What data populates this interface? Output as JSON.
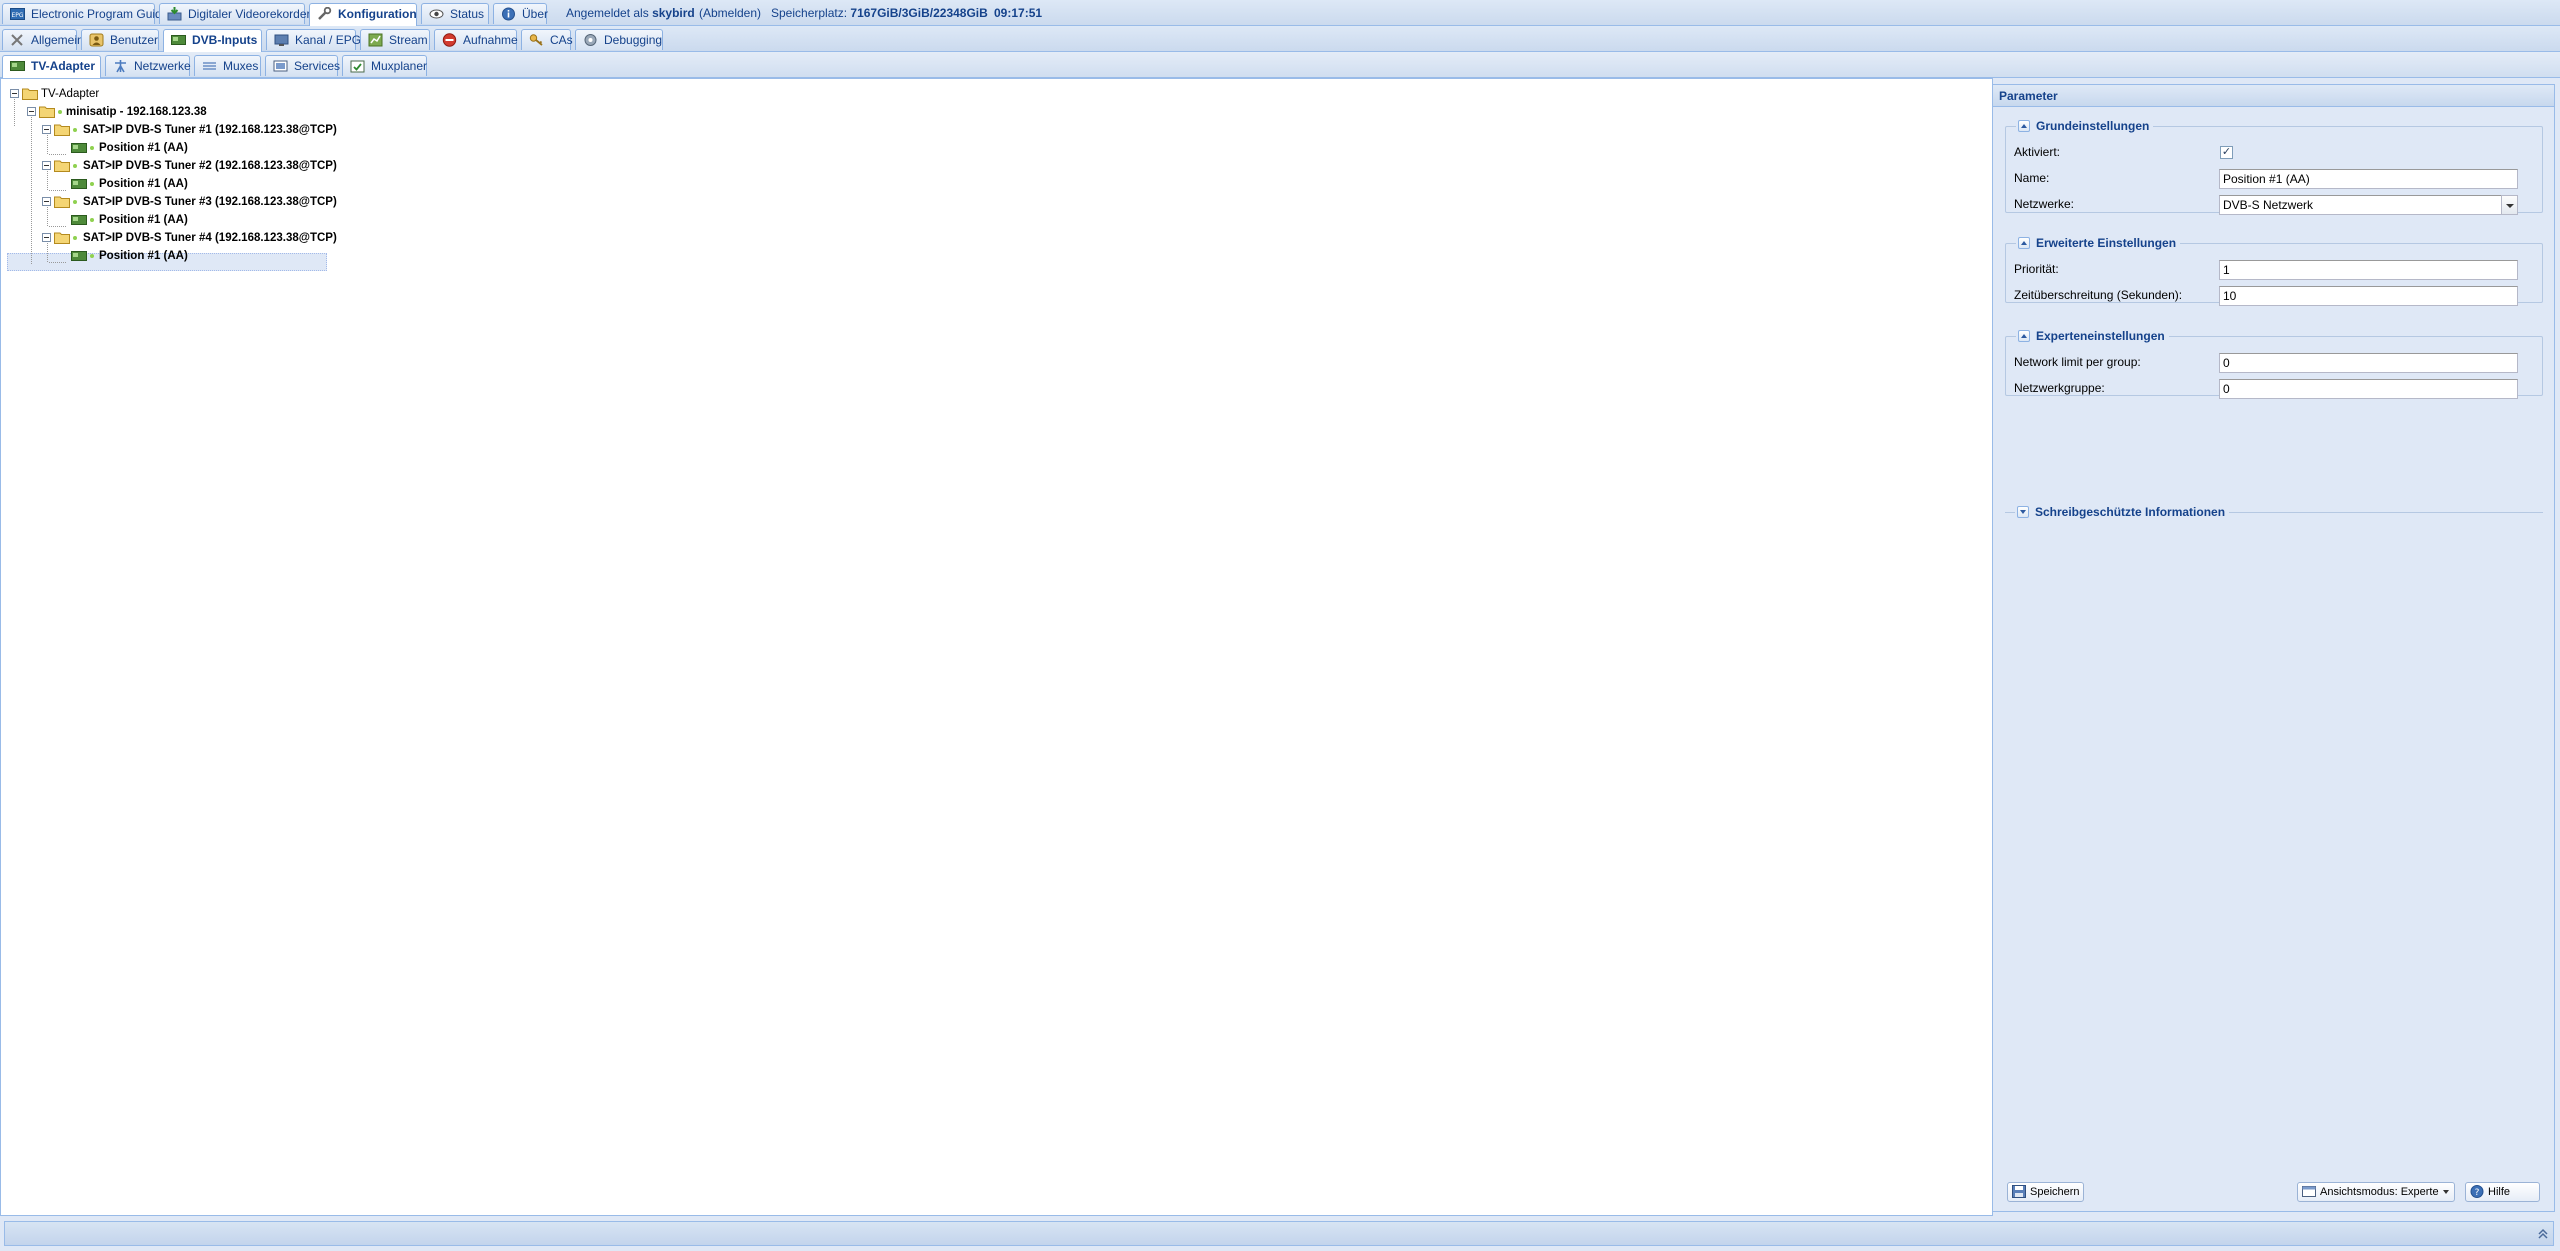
{
  "top_tabs": [
    {
      "id": "epg",
      "label": "Electronic Program Guide",
      "active": false,
      "icon": "epg-icon"
    },
    {
      "id": "dvr",
      "label": "Digitaler Videorekorder",
      "active": false,
      "icon": "recorder-icon"
    },
    {
      "id": "config",
      "label": "Konfiguration",
      "active": true,
      "icon": "wrench-icon"
    },
    {
      "id": "status",
      "label": "Status",
      "active": false,
      "icon": "eye-icon"
    },
    {
      "id": "about",
      "label": "Über",
      "active": false,
      "icon": "info-icon"
    }
  ],
  "session": {
    "logged_in_prefix": "Angemeldet als",
    "username": "skybird",
    "logout": "(Abmelden)",
    "storage_prefix": "Speicherplatz:",
    "storage": "7167GiB/3GiB/22348GiB",
    "time": "09:17:51"
  },
  "config_tabs": [
    {
      "label": "Allgemein",
      "active": false,
      "icon": "tools-icon"
    },
    {
      "label": "Benutzer",
      "active": false,
      "icon": "users-icon"
    },
    {
      "label": "DVB-Inputs",
      "active": true,
      "icon": "tv-card-icon"
    },
    {
      "label": "Kanal / EPG",
      "active": false,
      "icon": "tv-icon"
    },
    {
      "label": "Stream",
      "active": false,
      "icon": "stream-icon"
    },
    {
      "label": "Aufnahme",
      "active": false,
      "icon": "stop-icon"
    },
    {
      "label": "CAs",
      "active": false,
      "icon": "key-icon"
    },
    {
      "label": "Debugging",
      "active": false,
      "icon": "bug-icon"
    }
  ],
  "dvb_tabs": [
    {
      "label": "TV-Adapter",
      "active": true,
      "icon": "adapter-icon"
    },
    {
      "label": "Netzwerke",
      "active": false,
      "icon": "network-icon"
    },
    {
      "label": "Muxes",
      "active": false,
      "icon": "mux-icon"
    },
    {
      "label": "Services",
      "active": false,
      "icon": "services-icon"
    },
    {
      "label": "Muxplaner",
      "active": false,
      "icon": "scheduler-icon"
    }
  ],
  "tree": {
    "root": "TV-Adapter",
    "device": "minisatip - 192.168.123.38",
    "tuners": [
      {
        "label": "SAT>IP DVB-S Tuner #1 (192.168.123.38@TCP)",
        "position": "Position #1 (AA)"
      },
      {
        "label": "SAT>IP DVB-S Tuner #2 (192.168.123.38@TCP)",
        "position": "Position #1 (AA)"
      },
      {
        "label": "SAT>IP DVB-S Tuner #3 (192.168.123.38@TCP)",
        "position": "Position #1 (AA)"
      },
      {
        "label": "SAT>IP DVB-S Tuner #4 (192.168.123.38@TCP)",
        "position": "Position #1 (AA)"
      }
    ]
  },
  "params": {
    "title": "Parameter",
    "basic": {
      "legend": "Grundeinstellungen",
      "enabled_label": "Aktiviert:",
      "enabled_mark": "✓",
      "name_label": "Name:",
      "name_value": "Position #1 (AA)",
      "networks_label": "Netzwerke:",
      "networks_value": "DVB-S Netzwerk"
    },
    "advanced": {
      "legend": "Erweiterte Einstellungen",
      "priority_label": "Priorität:",
      "priority_value": "1",
      "timeout_label": "Zeitüberschreitung (Sekunden):",
      "timeout_value": "10"
    },
    "expert": {
      "legend": "Experteneinstellungen",
      "netlimit_label": "Network limit per group:",
      "netlimit_value": "0",
      "netgroup_label": "Netzwerkgruppe:",
      "netgroup_value": "0"
    },
    "readonly": {
      "legend": "Schreibgeschützte Informationen"
    },
    "save_label": "Speichern",
    "viewmode_label": "Ansichtsmodus: Experte",
    "help_label": "Hilfe"
  },
  "colors": {
    "accent": "#15428b",
    "border": "#99bbe8",
    "background": "#dfe8f6",
    "status_ok": "#8fd14f"
  }
}
